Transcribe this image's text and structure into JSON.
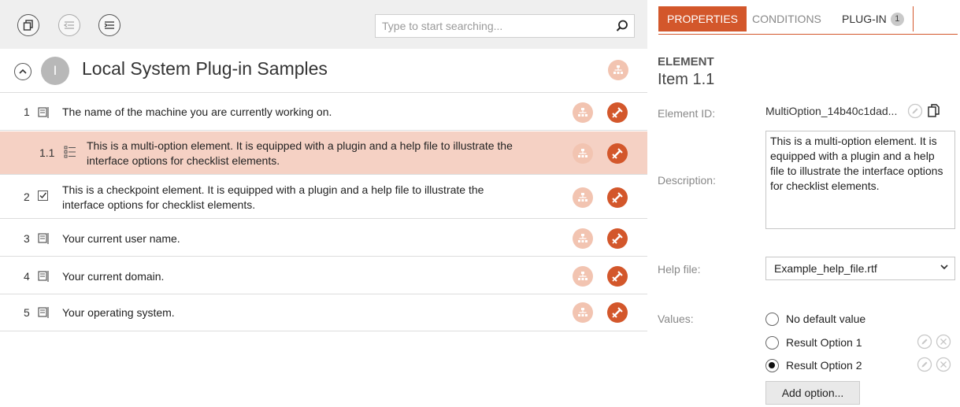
{
  "toolbar": {
    "search_placeholder": "Type to start searching...",
    "icons": [
      "copy-icon",
      "outdent-icon",
      "indent-icon",
      "search-icon"
    ]
  },
  "checklist": {
    "root": {
      "badge": "I",
      "title": "Local System Plug-in Samples"
    },
    "rows": [
      {
        "number": "1",
        "type": "text-element-icon",
        "text": "The name of the machine you are currently working on."
      },
      {
        "number": "1.1",
        "type": "multi-option-icon",
        "text_line1": "This is a multi-option element. It is equipped with a plugin and a help file to illustrate the",
        "text_line2": "interface options for checklist elements.",
        "selected": true
      },
      {
        "number": "2",
        "type": "checkpoint-icon",
        "text_line1": "This is a checkpoint element. It is equipped with a plugin and a help file to illustrate the",
        "text_line2": "interface options for checklist elements."
      },
      {
        "number": "3",
        "type": "text-element-icon",
        "text": "Your current user name."
      },
      {
        "number": "4",
        "type": "text-element-icon",
        "text": "Your current domain."
      },
      {
        "number": "5",
        "type": "text-element-icon",
        "text": "Your operating system."
      }
    ]
  },
  "colors": {
    "accent": "#d3572b",
    "accent_light": "#f2c4b1",
    "selected_row": "#f5d1c4",
    "toolbar_bg": "#efefef"
  },
  "properties": {
    "tabs": [
      {
        "label": "PROPERTIES",
        "active": true
      },
      {
        "label": "CONDITIONS",
        "active": false
      },
      {
        "label": "PLUG-IN",
        "count": "1",
        "active": false
      }
    ],
    "element_heading": "ELEMENT",
    "element_name": "Item  1.1",
    "labels": {
      "element_id": "Element ID:",
      "description": "Description:",
      "help_file": "Help file:",
      "values": "Values:"
    },
    "element_id": "MultiOption_14b40c1dad...",
    "description": "This is a multi-option element. It is equipped with a plugin and a help file to illustrate the interface options for checklist elements.",
    "help_file": "Example_help_file.rtf",
    "values": [
      {
        "label": "No default value",
        "checked": false
      },
      {
        "label": "Result Option 1",
        "checked": false
      },
      {
        "label": "Result Option 2",
        "checked": true
      }
    ],
    "add_option_label": "Add option..."
  }
}
